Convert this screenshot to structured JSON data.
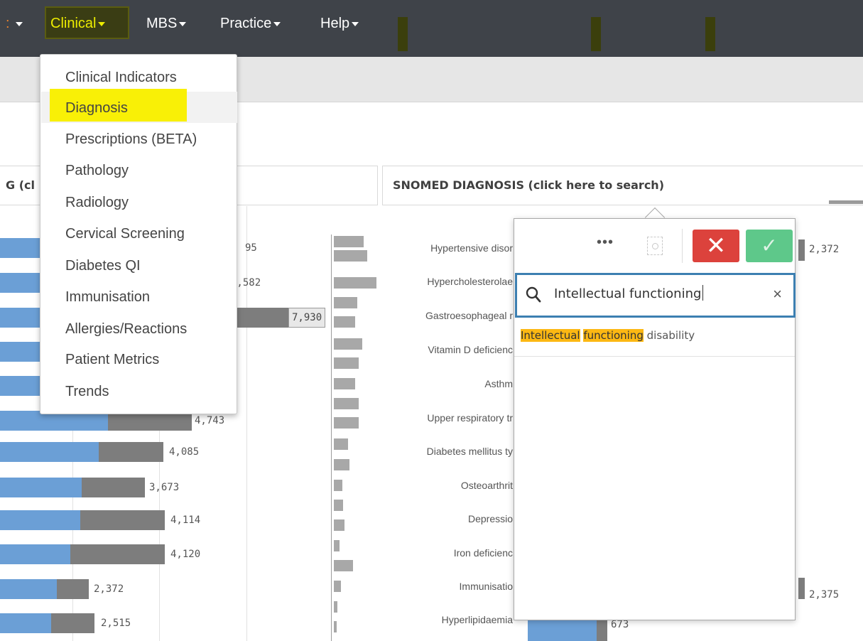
{
  "nav": {
    "items": [
      "Clinical",
      "MBS",
      "Practice",
      "Help"
    ]
  },
  "menu": {
    "items": [
      "Clinical Indicators",
      "Diagnosis",
      "Prescriptions (BETA)",
      "Pathology",
      "Radiology",
      "Cervical Screening",
      "Diabetes QI",
      "Immunisation",
      "Allergies/Reactions",
      "Patient Metrics",
      "Trends"
    ],
    "active_index": 1
  },
  "left_panel": {
    "title": "G (cl"
  },
  "snomed_panel": {
    "title": "SNOMED DIAGNOSIS (click here to search)"
  },
  "left_chart": {
    "values": [
      "95",
      "5,582",
      "7,930",
      "4,743",
      "4,085",
      "3,673",
      "4,114",
      "4,120",
      "2,372",
      "2,515"
    ]
  },
  "snomed_labels": [
    "Hypertensive disor",
    "Hypercholesterolae",
    "Gastroesophageal r",
    "Vitamin D deficienc",
    "Asthm",
    "Upper respiratory tr",
    "Diabetes mellitus ty",
    "Osteoarthrit",
    "Depressio",
    "Iron deficienc",
    "Immunisatio",
    "Hyperlipidaemia"
  ],
  "right_values": [
    "2,372",
    "2,375",
    "673"
  ],
  "search": {
    "query": "Intellectual functioning",
    "result_parts": [
      "Intellectual",
      "functioning",
      "disability"
    ],
    "clear_symbol": "×",
    "cancel_symbol": "✕",
    "confirm_symbol": "✓",
    "more_symbol": "•••"
  },
  "colors": {
    "nav_bg": "#3f4349",
    "bar_blue": "#6b9fd6",
    "bar_gray": "#7d7d7d",
    "highlight_yellow": "#f9f006",
    "search_highlight": "#fcb813",
    "cancel_red": "#dc423c",
    "confirm_green": "#5ec88a"
  }
}
